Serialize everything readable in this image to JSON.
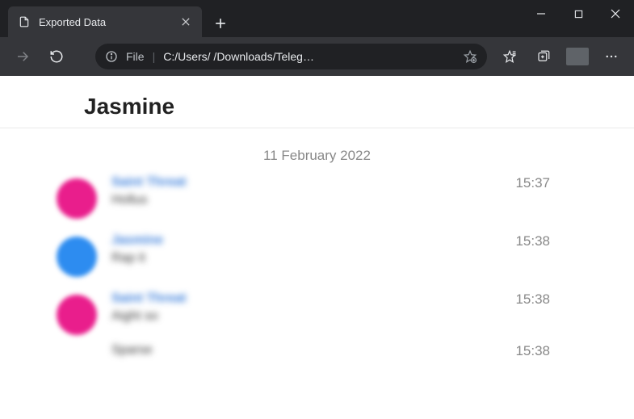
{
  "browser": {
    "tab_title": "Exported Data",
    "address_label": "File",
    "address_path": "C:/Users/        /Downloads/Teleg…"
  },
  "page": {
    "title": "Jasmine",
    "date": "11 February 2022"
  },
  "messages": [
    {
      "avatar": "pink",
      "sender": "Saint Threat",
      "text": "Hollus",
      "time": "15:37"
    },
    {
      "avatar": "blue",
      "sender": "Jasmine",
      "text": "Rap it",
      "time": "15:38"
    },
    {
      "avatar": "pink",
      "sender": "Saint Threat",
      "text": "Aight so",
      "time": "15:38"
    },
    {
      "avatar": "",
      "sender": "",
      "text": "Sparse",
      "time": "15:38"
    }
  ]
}
